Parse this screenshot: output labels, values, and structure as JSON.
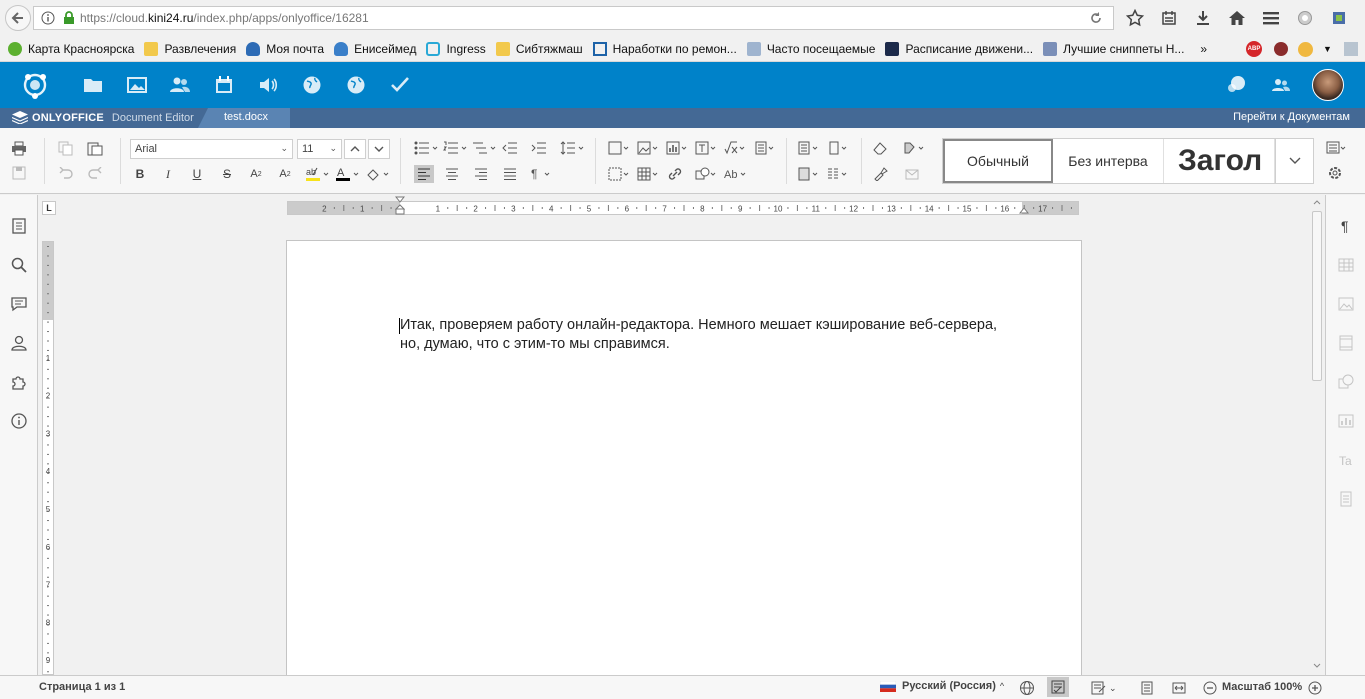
{
  "browser": {
    "url_prefix": "https://cloud.",
    "url_host": "kini24.ru",
    "url_path": "/index.php/apps/onlyoffice/16281",
    "bookmarks": [
      {
        "label": "Карта Красноярска",
        "icon": "green-circle-icon"
      },
      {
        "label": "Развлечения",
        "icon": "folder-icon"
      },
      {
        "label": "Моя почта",
        "icon": "mail-icon"
      },
      {
        "label": "Енисеймед",
        "icon": "site-icon"
      },
      {
        "label": "Ingress",
        "icon": "ingress-icon"
      },
      {
        "label": "Сибтяжмаш",
        "icon": "folder-icon"
      },
      {
        "label": "Наработки по ремон...",
        "icon": "site-icon"
      },
      {
        "label": "Часто посещаемые",
        "icon": "site-icon"
      },
      {
        "label": "Расписание движени...",
        "icon": "bus-icon"
      },
      {
        "label": "Лучшие сниппеты Н...",
        "icon": "s-icon"
      }
    ],
    "more_label": "»",
    "abp_label": "ABP"
  },
  "editor": {
    "brand": "ONLYOFFICE",
    "product": "Document Editor",
    "file_name": "test.docx",
    "goto_docs": "Перейти к Документам",
    "font_name": "Arial",
    "font_size": "11",
    "styles": [
      "Обычный",
      "Без интерва",
      "Загол"
    ]
  },
  "document": {
    "lines": [
      "Итак, проверяем работу онлайн-редактора. Немного мешает кэширование веб-сервера,",
      "но, думаю, что с этим-то мы справимся."
    ]
  },
  "ruler": {
    "h_labels": [
      "2",
      "1",
      "1",
      "2",
      "3",
      "4",
      "5",
      "6",
      "7",
      "8",
      "9",
      "10",
      "11",
      "12",
      "13",
      "14",
      "15",
      "16",
      "17"
    ],
    "v_labels": [
      "1",
      "2",
      "3",
      "4",
      "5",
      "6",
      "7",
      "8",
      "9"
    ]
  },
  "status": {
    "page_info": "Страница 1 из 1",
    "language": "Русский (Россия)",
    "zoom": "Масштаб 100%"
  },
  "colors": {
    "header_blue": "#0082c9",
    "docbar_blue": "#446995",
    "tab_blue": "#5a84b3",
    "highlight_yellow": "#f7e21b"
  }
}
